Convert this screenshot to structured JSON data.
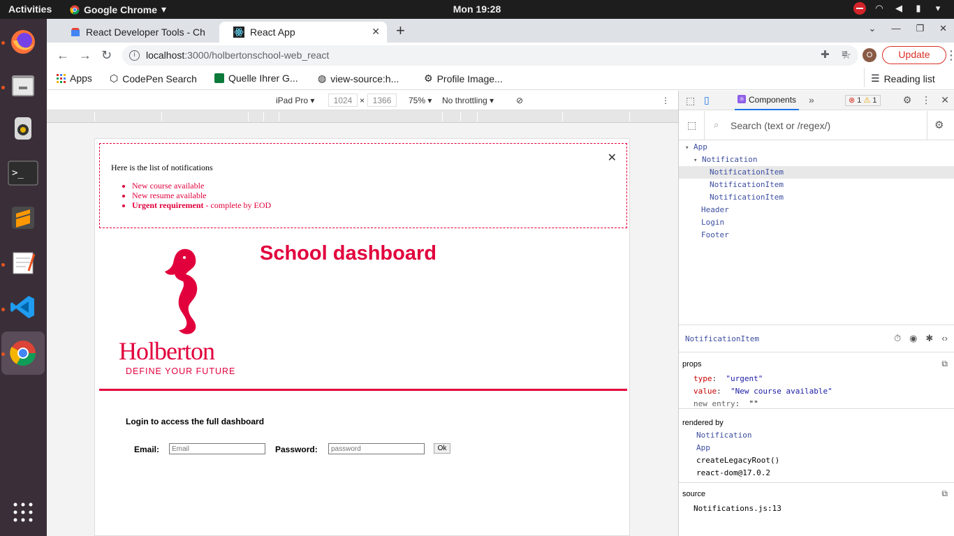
{
  "os": {
    "activities": "Activities",
    "app_name": "Google Chrome",
    "clock": "Mon 19:28"
  },
  "browser": {
    "tabs": [
      {
        "label": "React Developer Tools - Ch"
      },
      {
        "label": "React App"
      }
    ],
    "url_host": "localhost",
    "url_path": ":3000/holbertonschool-web_react",
    "update_label": "Update",
    "profile_initial": "O",
    "bookmarks": [
      {
        "label": "Apps"
      },
      {
        "label": "CodePen Search"
      },
      {
        "label": "Quelle Ihrer G..."
      },
      {
        "label": "view-source:h..."
      },
      {
        "label": "Profile Image..."
      }
    ],
    "reading_list": "Reading list"
  },
  "device_toolbar": {
    "device": "iPad Pro",
    "width": "1024",
    "height": "1366",
    "zoom": "75%",
    "throttling": "No throttling"
  },
  "page": {
    "notifications_title": "Here is the list of notifications",
    "notification_items": [
      {
        "text": "New course available"
      },
      {
        "text": "New resume available"
      }
    ],
    "urgent_bold": "Urgent requirement",
    "urgent_rest": " - complete by EOD",
    "brand_name": "Holberton",
    "brand_tagline": "DEFINE YOUR FUTURE",
    "header_title": "School dashboard",
    "login_prompt": "Login to access the full dashboard",
    "email_label": "Email:",
    "email_placeholder": "Email",
    "password_label": "Password:",
    "password_placeholder": "password",
    "ok_label": "Ok",
    "accent_color": "#e1003c"
  },
  "devtools": {
    "components_tab": "Components",
    "error_count": "1",
    "warning_count": "1",
    "search_placeholder": "Search (text or /regex/)",
    "tree": [
      {
        "label": "App",
        "indent": 1,
        "arrow": true
      },
      {
        "label": "Notification",
        "indent": 2,
        "arrow": true
      },
      {
        "label": "NotificationItem",
        "indent": 3,
        "selected": true
      },
      {
        "label": "NotificationItem",
        "indent": 3
      },
      {
        "label": "NotificationItem",
        "indent": 3
      },
      {
        "label": "Header",
        "indent": 2
      },
      {
        "label": "Login",
        "indent": 2
      },
      {
        "label": "Footer",
        "indent": 2
      }
    ],
    "selected_name": "NotificationItem",
    "props_title": "props",
    "props": [
      {
        "key": "type",
        "value": "\"urgent\""
      },
      {
        "key": "value",
        "value": "\"New course available\""
      },
      {
        "key": "new entry",
        "value": "\"\""
      }
    ],
    "rendered_by_title": "rendered by",
    "rendered_by": [
      "Notification",
      "App",
      "createLegacyRoot()",
      "react-dom@17.0.2"
    ],
    "source_title": "source",
    "source": "Notifications.js:13"
  }
}
